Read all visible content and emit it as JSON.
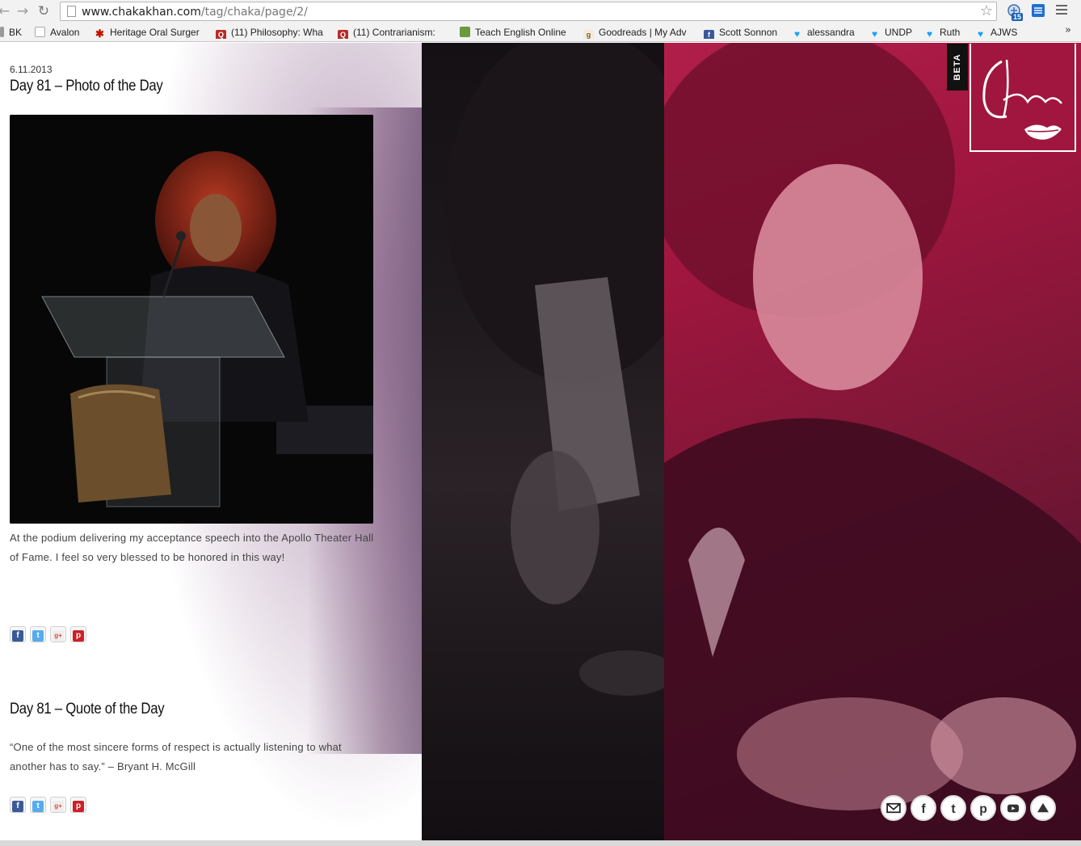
{
  "browser": {
    "url_host": "www.chakakhan.com",
    "url_path": "/tag/chaka/page/2/",
    "extension_badge": "15",
    "bookmarks": [
      {
        "label": "BK",
        "icon": "folder-icon"
      },
      {
        "label": "Avalon",
        "icon": "page-icon"
      },
      {
        "label": "Heritage Oral Surger",
        "icon": "yelp-icon",
        "color": "#c41200"
      },
      {
        "label": "(11) Philosophy: Wha",
        "icon": "quora-icon",
        "color": "#b92b27"
      },
      {
        "label": "(11) Contrarianism:",
        "icon": "quora-icon",
        "color": "#b92b27"
      },
      {
        "label": "Teach English Online",
        "icon": "feed-icon",
        "color": "#6a9a3a"
      },
      {
        "label": "Goodreads | My Adv",
        "icon": "goodreads-icon",
        "color": "#c9b08a"
      },
      {
        "label": "Scott Sonnon",
        "icon": "facebook-icon",
        "color": "#3b5998"
      },
      {
        "label": "alessandra",
        "icon": "twitter-icon",
        "color": "#1da1f2"
      },
      {
        "label": "UNDP",
        "icon": "twitter-icon",
        "color": "#1da1f2"
      },
      {
        "label": "Ruth",
        "icon": "twitter-icon",
        "color": "#1da1f2"
      },
      {
        "label": "AJWS",
        "icon": "twitter-icon",
        "color": "#1da1f2"
      }
    ],
    "bookmarks_overflow": "»"
  },
  "posts": [
    {
      "date": "6.11.2013",
      "title": "Day 81 – Photo of the Day",
      "caption": "At the podium delivering my acceptance speech into the Apollo Theater Hall of Fame.  I feel so very blessed to be honored in this way!"
    },
    {
      "title": "Day 81 – Quote of the Day",
      "caption": "“One of the most sincere forms of respect is actually listening to what another has to say.” – Bryant H. McGill"
    }
  ],
  "share_icons": [
    "facebook-icon",
    "twitter-icon",
    "google-plus-icon",
    "pinterest-icon"
  ],
  "share_glyphs": {
    "facebook": "f",
    "twitter": "t",
    "google_plus": "g+",
    "pinterest": "p"
  },
  "beta_label": "BETA",
  "logo_text": "Chaka",
  "social_footer": [
    "mail-icon",
    "facebook-icon",
    "twitter-icon",
    "pinterest-icon",
    "youtube-icon",
    "deviantart-icon"
  ],
  "colors": {
    "brand": "#a0163e",
    "facebook": "#3b5998",
    "twitter": "#55acee",
    "google_plus": "#dd4b39",
    "pinterest": "#cb2027"
  }
}
